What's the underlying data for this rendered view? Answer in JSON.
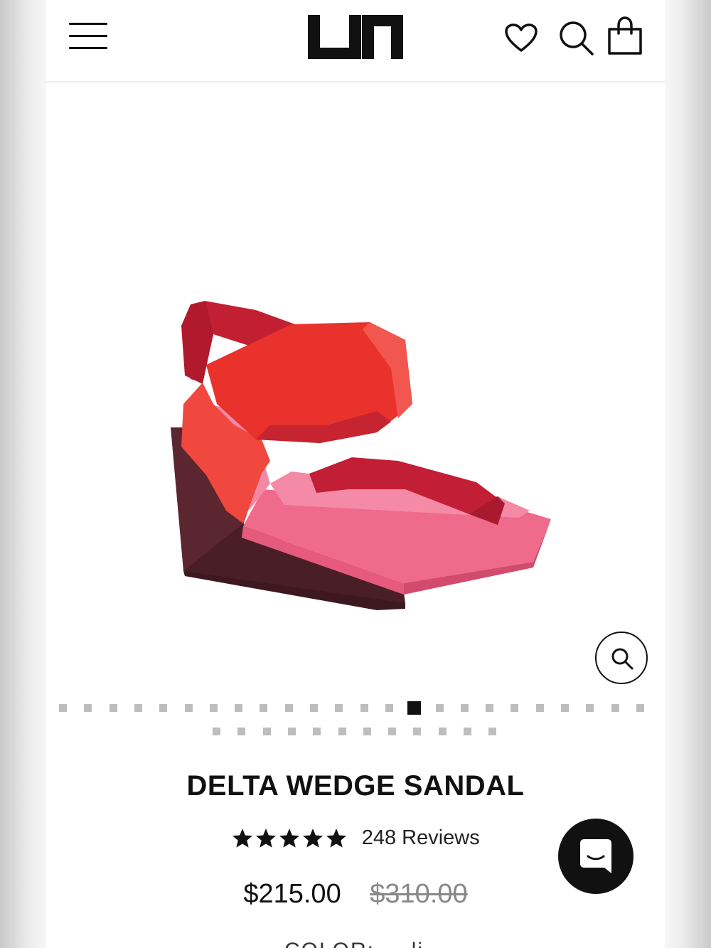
{
  "header": {
    "logo_text": "UN",
    "menu_icon": "hamburger-menu-icon",
    "wishlist_icon": "heart-icon",
    "search_icon": "search-icon",
    "cart_icon": "shopping-bag-icon"
  },
  "gallery": {
    "image_alt": "Delta Wedge Sandal",
    "zoom_icon": "magnifier-icon",
    "slides_total": 36,
    "active_slide": 14,
    "colors": {
      "strap_red": "#e8322b",
      "strap_dark": "#c21f34",
      "footbed_pink": "#f16c8e",
      "wedge_dark": "#5a2730"
    }
  },
  "product": {
    "title": "DELTA WEDGE SANDAL",
    "rating": 5,
    "reviews_label": "248 Reviews",
    "price_sale": "$215.00",
    "price_original": "$310.00",
    "color_label": "COLOR: ... li"
  },
  "chat": {
    "icon": "chat-bubble-icon"
  }
}
